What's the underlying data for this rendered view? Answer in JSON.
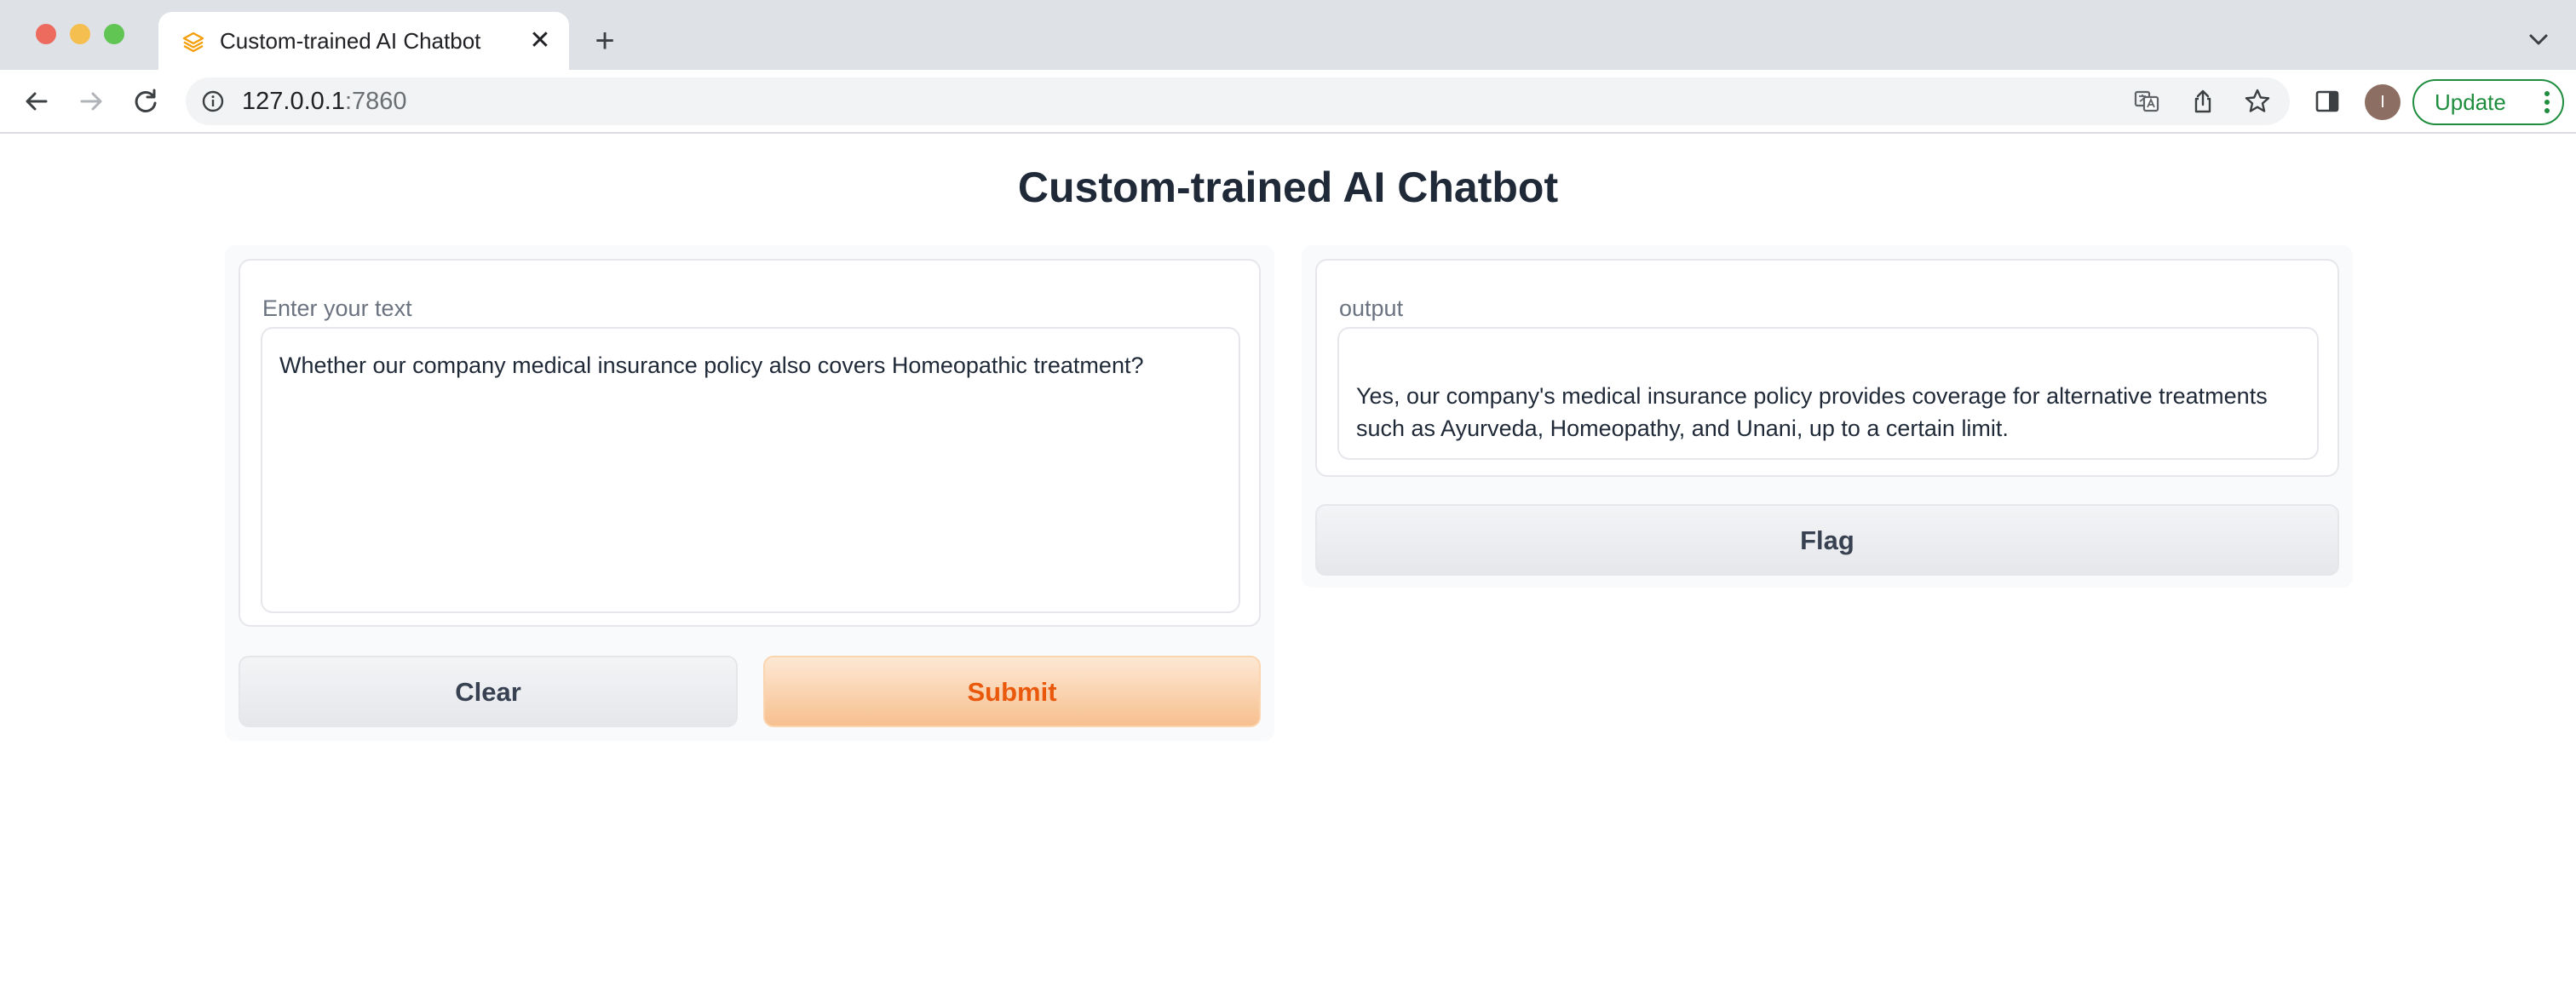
{
  "browser": {
    "tab_title": "Custom-trained AI Chatbot",
    "tab_close_glyph": "✕",
    "new_tab_glyph": "+",
    "url_host": "127.0.0.1",
    "url_port": ":7860",
    "avatar_initial": "I",
    "update_label": "Update",
    "icons": [
      "back-icon",
      "forward-icon",
      "reload-icon",
      "site-info-icon",
      "translate-icon",
      "share-icon",
      "bookmark-star-icon",
      "side-panel-icon",
      "more-vert-icon",
      "tab-list-chevron-icon"
    ],
    "accent_update": "#1e8e3e"
  },
  "app": {
    "title": "Custom-trained AI Chatbot",
    "input": {
      "label": "Enter your text",
      "value": "Whether our company medical insurance policy also covers Homeopathic treatment?"
    },
    "output": {
      "label": "output",
      "value": "Yes, our company's medical insurance policy provides coverage for alternative treatments such as Ayurveda, Homeopathy, and Unani, up to a certain limit."
    },
    "buttons": {
      "clear": "Clear",
      "submit": "Submit",
      "flag": "Flag"
    },
    "colors": {
      "primary_text": "#ea580c",
      "primary_bg": "#f7c08f",
      "secondary_bg": "#e5e7eb"
    }
  }
}
